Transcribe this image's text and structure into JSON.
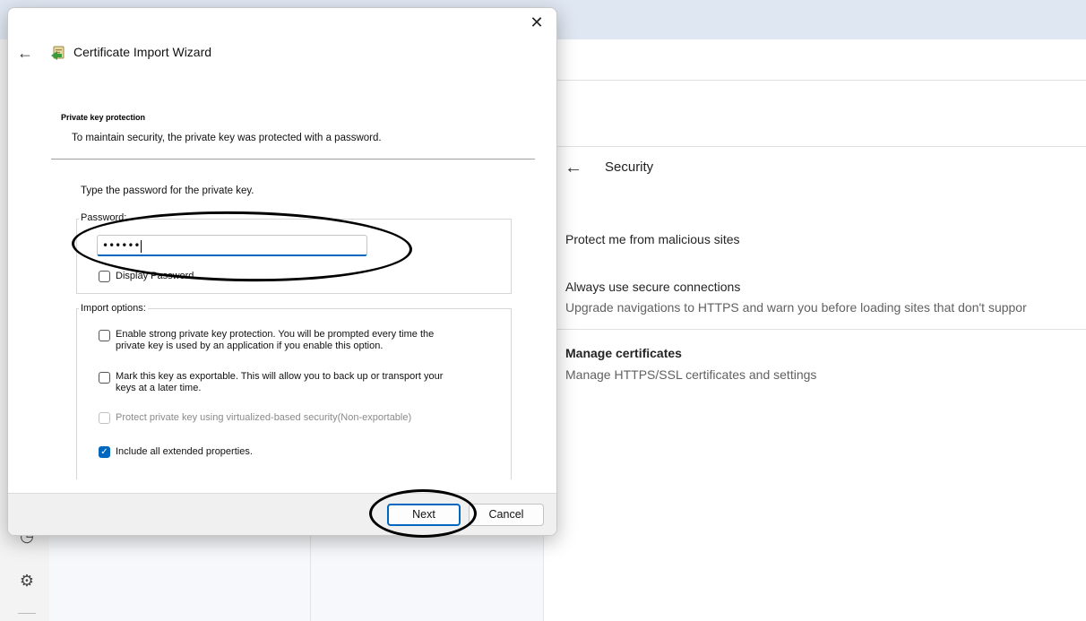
{
  "background": {
    "section": {
      "title": "Security"
    },
    "settings": [
      {
        "title": "Protect me from malicious sites",
        "description": ""
      },
      {
        "title": "Always use secure connections",
        "description": "Upgrade navigations to HTTPS and warn you before loading sites that don't suppor"
      },
      {
        "title": "Manage certificates",
        "description": "Manage HTTPS/SSL certificates and settings"
      }
    ]
  },
  "dialog": {
    "title": "Certificate Import Wizard",
    "close_glyph": "✕",
    "back_glyph": "←",
    "section_heading": "Private key protection",
    "section_subtitle": "To maintain security, the private key was protected with a password.",
    "prompt": "Type the password for the private key.",
    "password_group_label": "Password:",
    "password_value": "••••••",
    "display_password_label": "Display Password",
    "import_options_label": "Import options:",
    "options": [
      {
        "label_line1": "Enable strong private key protection. You will be prompted every time the",
        "label_line2": "private key is used by an application if you enable this option.",
        "checked": false,
        "enabled": true
      },
      {
        "label_line1": "Mark this key as exportable. This will allow you to back up or transport your",
        "label_line2": "keys at a later time.",
        "checked": false,
        "enabled": true
      },
      {
        "label_line1": "Protect private key using virtualized-based security(Non-exportable)",
        "label_line2": "",
        "checked": false,
        "enabled": false
      },
      {
        "label_line1": "Include all extended properties.",
        "label_line2": "",
        "checked": true,
        "enabled": true
      }
    ],
    "buttons": {
      "next": "Next",
      "cancel": "Cancel"
    }
  },
  "colors": {
    "accent": "#0067c0",
    "topbar": "#dfe7f2"
  },
  "icons": {
    "back": "back-arrow-icon",
    "close": "close-icon",
    "wizard": "certificate-wizard-icon",
    "settings": "gear-icon",
    "history": "history-icon"
  }
}
